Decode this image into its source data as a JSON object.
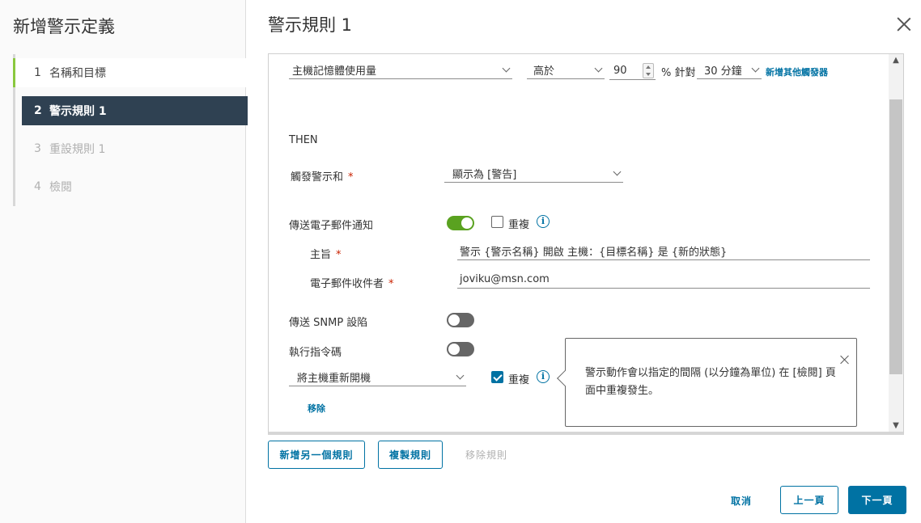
{
  "wizard": {
    "title": "新增警示定義",
    "steps": [
      {
        "num": "1",
        "label": "名稱和目標",
        "state": "done"
      },
      {
        "num": "2",
        "label": "警示規則 1",
        "state": "active"
      },
      {
        "num": "3",
        "label": "重設規則 1",
        "state": "disabled"
      },
      {
        "num": "4",
        "label": "檢閱",
        "state": "disabled"
      }
    ]
  },
  "header": {
    "title": "警示規則 1"
  },
  "condition": {
    "metric": "主機記憶體使用量",
    "operator": "高於",
    "threshold": "90",
    "unit_label": "% 針對",
    "duration": "30 分鐘",
    "add_trigger_link": "新增其他觸發器"
  },
  "then_section": {
    "label": "THEN",
    "trigger_label": "觸發警示和",
    "trigger_value": "顯示為 [警告]"
  },
  "email": {
    "label": "傳送電子郵件通知",
    "enabled": true,
    "repeat_label": "重複",
    "repeat_checked": false,
    "subject_label": "主旨",
    "subject_value": "警示 {警示名稱} 開啟 主機：{目標名稱} 是 {新的狀態}",
    "recipients_label": "電子郵件收件者",
    "recipients_value": "joviku@msn.com"
  },
  "snmp": {
    "label": "傳送 SNMP 設陷",
    "enabled": false
  },
  "script": {
    "label": "執行指令碼",
    "enabled": false,
    "action_value": "將主機重新開機",
    "repeat_label": "重複",
    "repeat_checked": true,
    "remove_link": "移除"
  },
  "tooltip": {
    "text": "警示動作會以指定的間隔 (以分鐘為單位) 在 [檢閱] 頁面中重複發生。"
  },
  "rule_buttons": {
    "add_rule": "新增另一個規則",
    "copy_rule": "複製規則",
    "remove_rule": "移除規則"
  },
  "footer": {
    "cancel": "取消",
    "back": "上一頁",
    "next": "下一頁"
  },
  "colors": {
    "accent": "#0072a3",
    "active_step_bg": "#2f4152",
    "done_step_bar": "#8ac83e",
    "toggle_on": "#5aa220",
    "required": "#c92100"
  }
}
